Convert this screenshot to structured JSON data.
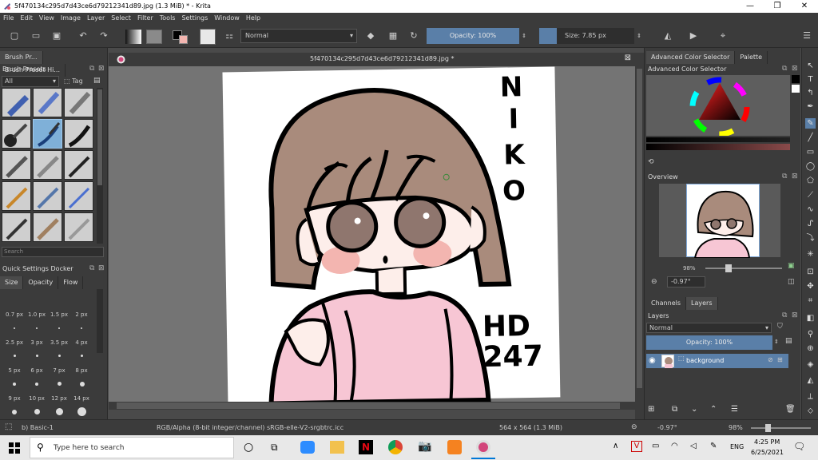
{
  "window": {
    "title": "5f470134c295d7d43ce6d79212341d89.jpg (1.3 MiB)  * - Krita",
    "minimize": "—",
    "maximize": "❐",
    "close": "✕"
  },
  "menu": [
    "File",
    "Edit",
    "View",
    "Image",
    "Layer",
    "Select",
    "Filter",
    "Tools",
    "Settings",
    "Window",
    "Help"
  ],
  "toolbar": {
    "blend_mode": "Normal",
    "opacity": "Opacity: 100%",
    "size": "Size: 7.85 px"
  },
  "left": {
    "tabs": [
      "Brush Pr...",
      "Brush Preset Hi..."
    ],
    "presets_title": "Brush Presets",
    "filter_all": "All",
    "tag_label": "Tag",
    "search_placeholder": "Search",
    "quick_title": "Quick Settings Docker",
    "quick_tabs": [
      "Size",
      "Opacity",
      "Flow"
    ],
    "sizes": [
      "0.7 px",
      "1.0 px",
      "1.5 px",
      "2 px",
      "2.5 px",
      "3 px",
      "3.5 px",
      "4 px",
      "5 px",
      "6 px",
      "7 px",
      "8 px",
      "9 px",
      "10 px",
      "12 px",
      "14 px"
    ]
  },
  "document": {
    "tab_title": "5f470134c295d7d43ce6d79212341d89.jpg *"
  },
  "right": {
    "tabs": [
      "Advanced Color Selector",
      "Palette"
    ],
    "color_selector_title": "Advanced Color Selector",
    "overview_title": "Overview",
    "zoom": "98%",
    "rotation": "-0.97°",
    "layer_tabs": [
      "Channels",
      "Layers"
    ],
    "layers_title": "Layers",
    "layer_mode": "Normal",
    "layer_opacity": "Opacity:  100%",
    "layer_name": "background"
  },
  "artwork": {
    "name_text": [
      "N",
      "I",
      "K",
      "O"
    ],
    "sig_line1": "HD",
    "sig_line2": "247",
    "colors": {
      "hair": "#a98b7c",
      "shirt": "#f7c6d4",
      "skin": "#fdeeea",
      "blush": "#f3b5b0",
      "eyes": "#8f766e"
    }
  },
  "status": {
    "brush": "b) Basic-1",
    "color_model": "RGB/Alpha (8-bit integer/channel)  sRGB-elle-V2-srgbtrc.icc",
    "dimensions": "564 x 564 (1.3 MiB)",
    "rotation": "-0.97°",
    "zoom": "98%"
  },
  "taskbar": {
    "search_placeholder": "Type here to search",
    "lang": "ENG",
    "time": "4:25 PM",
    "date": "6/25/2021"
  },
  "accent": "#5a7fa8"
}
